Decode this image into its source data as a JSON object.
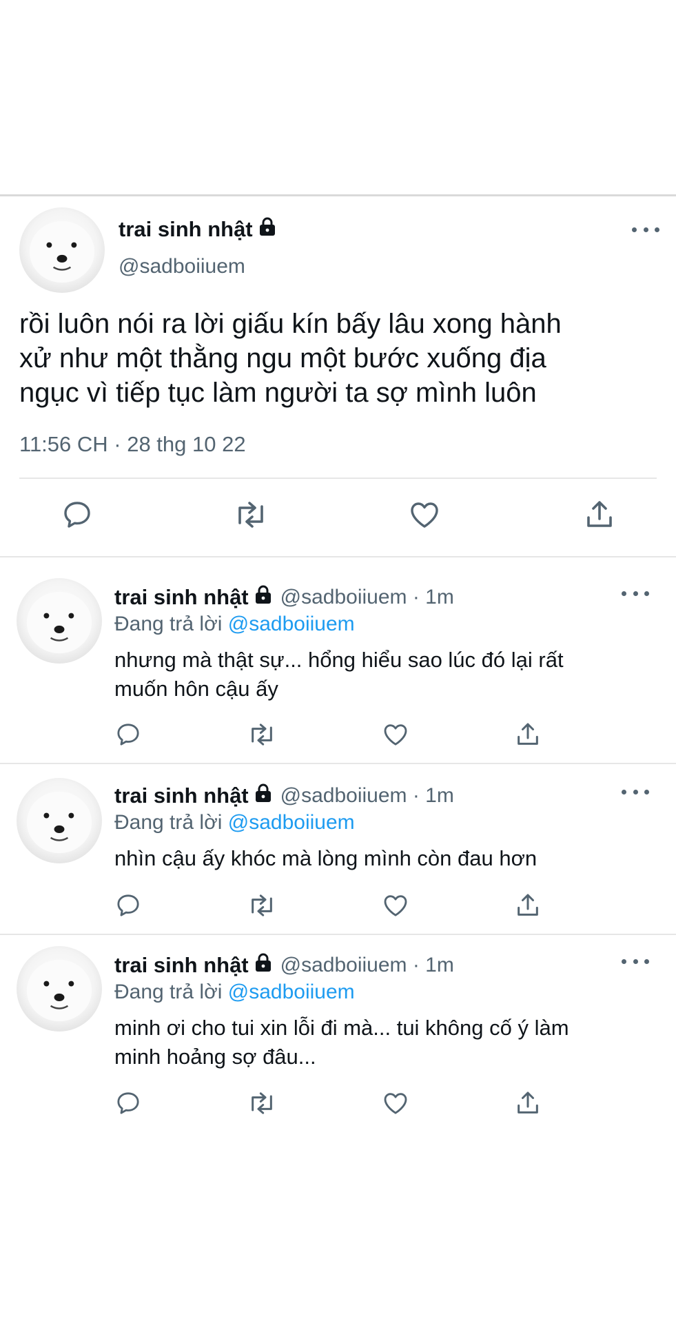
{
  "main_tweet": {
    "display_name": "trai sinh nhật",
    "handle": "@sadboiiuem",
    "text": "rồi luôn nói ra lời giấu kín bấy lâu xong hành\nxử như một thằng ngu một bước xuống địa\nngục vì tiếp tục làm người ta sợ mình luôn",
    "timestamp": "11:56 CH · 28 thg 10 22",
    "actions": [
      "reply-icon",
      "retweet-icon",
      "like-icon",
      "share-icon"
    ]
  },
  "replies": [
    {
      "display_name": "trai sinh nhật",
      "meta": "@sadboiiuem · 1m",
      "replying_prefix": "Đang trả lời ",
      "replying_to": "@sadboiiuem",
      "text": " nhưng mà thật sự... hổng hiểu sao lúc đó lại rất\nmuốn hôn cậu ấy"
    },
    {
      "display_name": "trai sinh nhật",
      "meta": "@sadboiiuem · 1m",
      "replying_prefix": "Đang trả lời ",
      "replying_to": "@sadboiiuem",
      "text": "nhìn cậu ấy khóc mà lòng mình còn đau hơn"
    },
    {
      "display_name": "trai sinh nhật",
      "meta": "@sadboiiuem · 1m",
      "replying_prefix": "Đang trả lời ",
      "replying_to": "@sadboiiuem",
      "text": "minh ơi cho tui xin lỗi đi mà... tui không cố ý làm\nminh hoảng sợ đâu..."
    }
  ],
  "colors": {
    "text": "#0f1419",
    "secondary": "#536471",
    "link": "#1d9bf0",
    "divider": "#e6e6e6"
  }
}
